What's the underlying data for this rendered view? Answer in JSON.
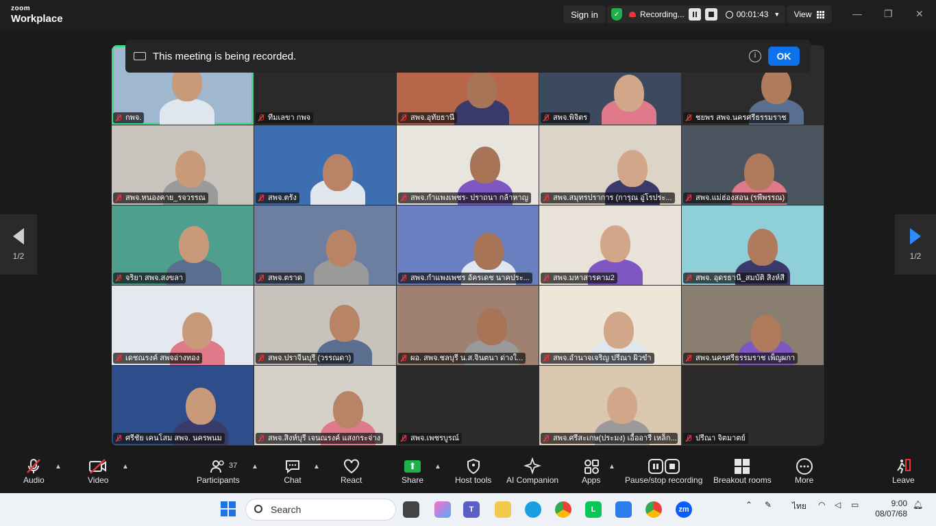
{
  "titlebar": {
    "brand_small": "zoom",
    "brand_large": "Workplace",
    "signin": "Sign in",
    "recording": "Recording...",
    "elapsed": "00:01:43",
    "view": "View",
    "min": "—",
    "max": "❐",
    "close": "✕"
  },
  "banner": {
    "message": "This meeting is being recorded.",
    "info": "i",
    "ok": "OK"
  },
  "pager": {
    "left": "1/2",
    "right": "1/2"
  },
  "tiles": [
    {
      "name": "กพจ.",
      "heading": ""
    },
    {
      "name": "ทีมเลขา กพจ",
      "heading": "ทีมเลขา กพจ"
    },
    {
      "name": "สพจ.อุทัยธานี",
      "heading": ""
    },
    {
      "name": "สพจ.พิจิตร",
      "heading": ""
    },
    {
      "name": "ชยพร สพจ.นครศรีธรรมราช",
      "heading": ""
    },
    {
      "name": "สพจ.หนองคาย_รจวรรณ",
      "heading": ""
    },
    {
      "name": "สพจ.ตรัง",
      "heading": ""
    },
    {
      "name": "สพจ.กำแพงเพชร- ปราถนา กล้าหาญ",
      "heading": ""
    },
    {
      "name": "สพจ.สมุทรปราการ (การุณ อู่โรประ...",
      "heading": ""
    },
    {
      "name": "สพจ.แม่ฮ่องสอน (รพีพรรณ)",
      "heading": ""
    },
    {
      "name": "จริยา สพจ.สงขลา",
      "heading": ""
    },
    {
      "name": "สพจ.ตราด",
      "heading": ""
    },
    {
      "name": "สพจ.กำแพงเพชร อัครเดช นาคประ...",
      "heading": ""
    },
    {
      "name": "สพจ.มหาสารคาม2",
      "heading": ""
    },
    {
      "name": "สพจ. อุดรธานี_สมบัติ สิงห์สี",
      "heading": ""
    },
    {
      "name": "เดชณรงค์        สพจอ่างทอง",
      "heading": ""
    },
    {
      "name": "สพจ.ปราจีนบุรี (วรรณดา)",
      "heading": ""
    },
    {
      "name": "ผอ. สพจ.ชลบุรี น.ส.จินตนา ด่างใ...",
      "heading": ""
    },
    {
      "name": "สพจ.อำนาจเจริญ ปรีณา ผิวขำ",
      "heading": ""
    },
    {
      "name": "สพจ.นครศรีธรรมราช เพ็ญผกา",
      "heading": ""
    },
    {
      "name": "ศรีชัย เคนโสม สพจ. นครพนม",
      "heading": ""
    },
    {
      "name": "สพจ.สิงห์บุรี เจนณรงค์ แสงกระจ่าง",
      "heading": ""
    },
    {
      "name": "สพจ.เพชรบูรณ์",
      "heading": ""
    },
    {
      "name": "สพจ.ศรีสะเกษ(ประมง) เอื้ออารี เหล็ก...",
      "heading": ""
    },
    {
      "name": "ปรีณา จิตมาตย์",
      "heading": ""
    }
  ],
  "toolbar": {
    "audio": "Audio",
    "video": "Video",
    "participants": "Participants",
    "participants_count": "37",
    "chat": "Chat",
    "react": "React",
    "share": "Share",
    "host_tools": "Host tools",
    "ai_companion": "AI Companion",
    "apps": "Apps",
    "pause_stop": "Pause/stop recording",
    "breakout": "Breakout rooms",
    "more": "More",
    "leave": "Leave"
  },
  "taskbar": {
    "search": "Search",
    "lang": "ไทย",
    "time": "9:00",
    "date": "08/07/68"
  },
  "colors": {
    "accent": "#0e72ed",
    "active_speaker": "#3ddc84",
    "muted": "#e8343a",
    "share": "#1fb24c"
  }
}
